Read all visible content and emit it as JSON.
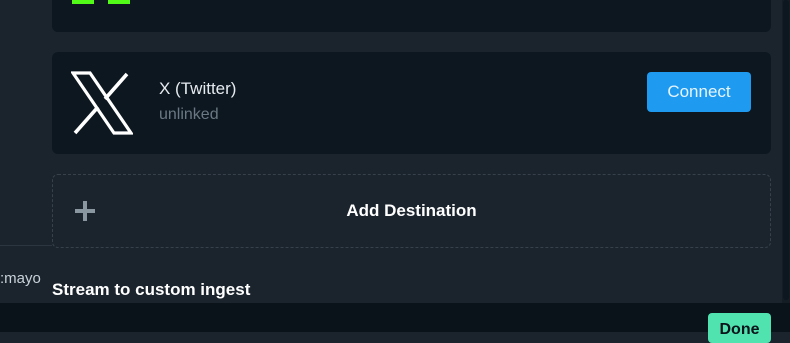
{
  "sidebar": {
    "fragment_text": "mayo"
  },
  "destinations": [
    {
      "name": "X (Twitter)",
      "status": "unlinked",
      "action_label": "Connect",
      "icon": "x-logo-icon",
      "accent_color": "#1e9bf0"
    }
  ],
  "add_destination": {
    "label": "Add Destination",
    "icon": "plus-icon"
  },
  "section": {
    "heading": "Stream to custom ingest"
  },
  "footer": {
    "done_label": "Done",
    "done_color": "#50e3b0"
  },
  "top_card": {
    "brand_color": "#53fc18"
  }
}
